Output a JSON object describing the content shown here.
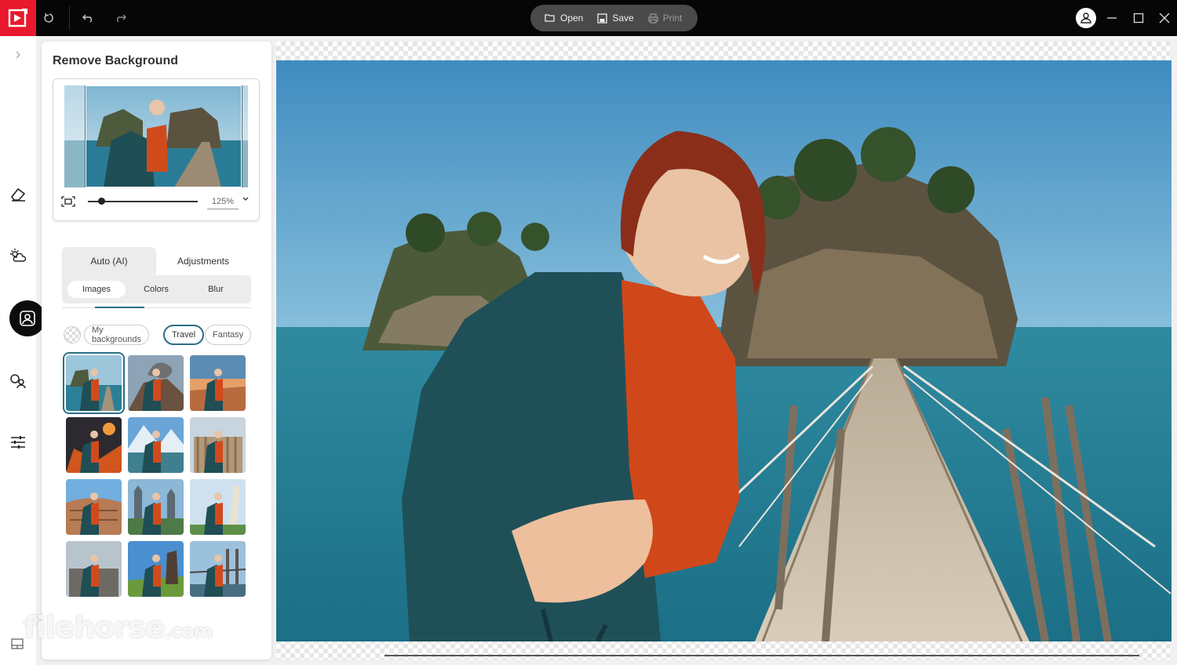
{
  "app": {
    "toolbar": {
      "open_label": "Open",
      "save_label": "Save",
      "print_label": "Print"
    }
  },
  "panel": {
    "title": "Remove Background",
    "zoom": {
      "value": "125%",
      "level": 0.12
    },
    "tabs": [
      {
        "label": "Auto (AI)",
        "active": true
      },
      {
        "label": "Adjustments",
        "active": false
      }
    ],
    "subtabs": [
      {
        "label": "Images",
        "active": true
      },
      {
        "label": "Colors",
        "active": false
      },
      {
        "label": "Blur",
        "active": false
      }
    ],
    "categories": [
      {
        "label": "My backgrounds",
        "selected": false
      },
      {
        "label": "Travel",
        "selected": true
      },
      {
        "label": "Fantasy",
        "selected": false
      }
    ],
    "thumbnails": [
      {
        "name": "pier-island",
        "selected": true
      },
      {
        "name": "volcano"
      },
      {
        "name": "desert-sunset"
      },
      {
        "name": "lava-fantasy"
      },
      {
        "name": "mountain-lake"
      },
      {
        "name": "greek-temple"
      },
      {
        "name": "colosseum"
      },
      {
        "name": "castle"
      },
      {
        "name": "leaning-tower"
      },
      {
        "name": "ruins"
      },
      {
        "name": "moai"
      },
      {
        "name": "bridge"
      }
    ]
  },
  "watermark": {
    "text": "filehorse",
    "suffix": ".com"
  },
  "colors": {
    "brand": "#e8192c",
    "accent": "#2a6f86"
  },
  "icons": {
    "rail": [
      "chevron-right-icon",
      "eraser-icon",
      "weather-icon",
      "remove-background-icon",
      "replace-person-icon",
      "adjustments-icon",
      "layout-icon"
    ]
  }
}
